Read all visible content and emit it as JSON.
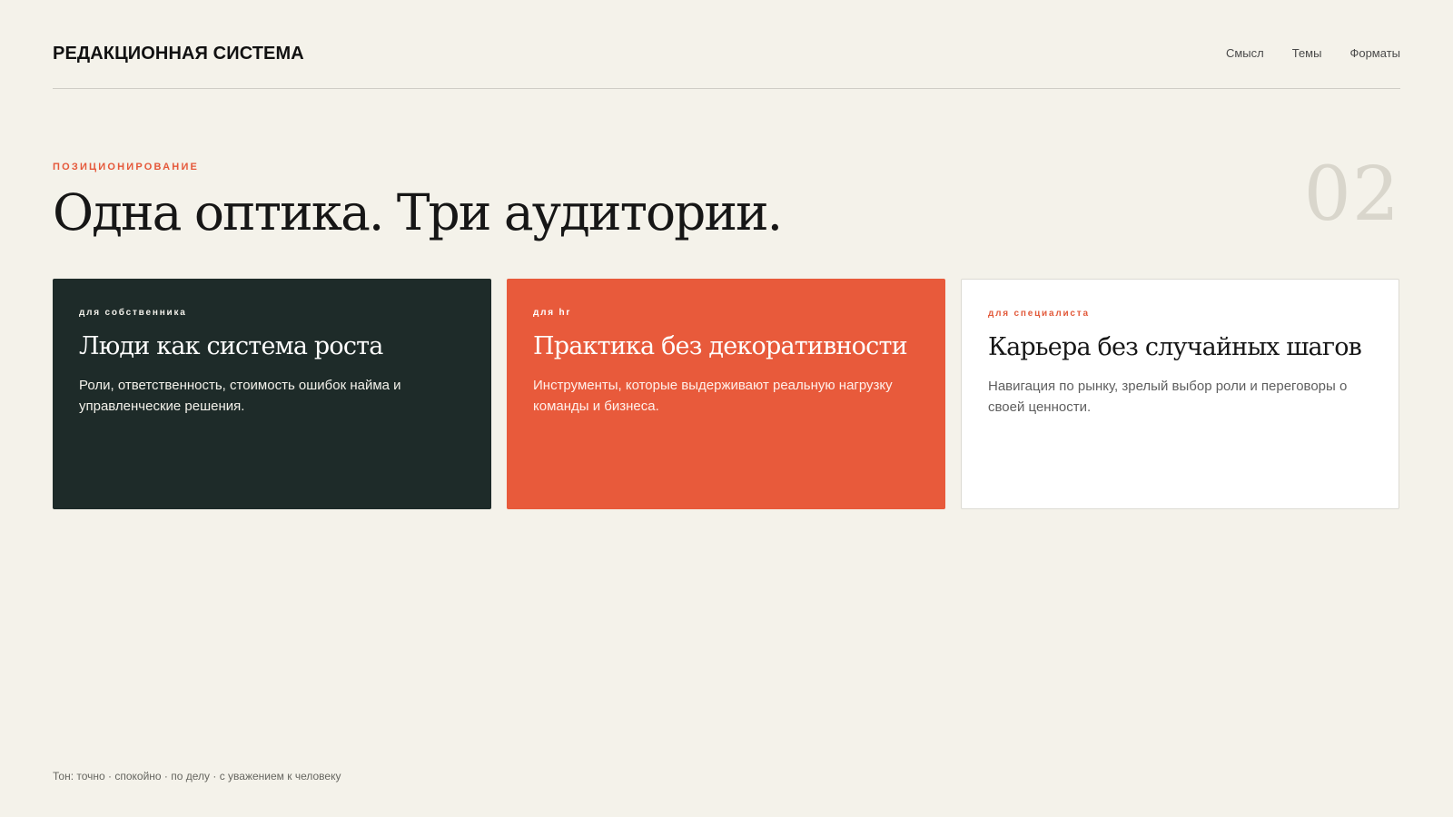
{
  "header": {
    "brand": "РЕДАКЦИОННАЯ СИСТЕМА",
    "nav": [
      {
        "label": "Смысл"
      },
      {
        "label": "Темы"
      },
      {
        "label": "Форматы"
      }
    ]
  },
  "section": {
    "eyebrow": "ПОЗИЦИОНИРОВАНИЕ",
    "headline": "Одна оптика. Три аудитории.",
    "number": "02"
  },
  "cards": [
    {
      "label": "для собственника",
      "title": "Люди как система роста",
      "text": "Роли, ответственность, стоимость ошибок найма и управленческие решения.",
      "color": "#1e2b29"
    },
    {
      "label": "для HR",
      "title": "Практика без декоративности",
      "text": "Инструменты, которые выдерживают реальную нагрузку команды и бизнеса.",
      "color": "#e85a3b"
    },
    {
      "label": "для специалиста",
      "title": "Карьера без случайных шагов",
      "text": "Навигация по рынку, зрелый выбор роли и переговоры о своей ценности.",
      "color": "#ffffff"
    }
  ],
  "footer": {
    "tone": "Тон: точно · спокойно · по делу · с уважением к человеку"
  },
  "colors": {
    "background": "#f4f2ea",
    "accent": "#e85a3b",
    "dark": "#1e2b29"
  }
}
